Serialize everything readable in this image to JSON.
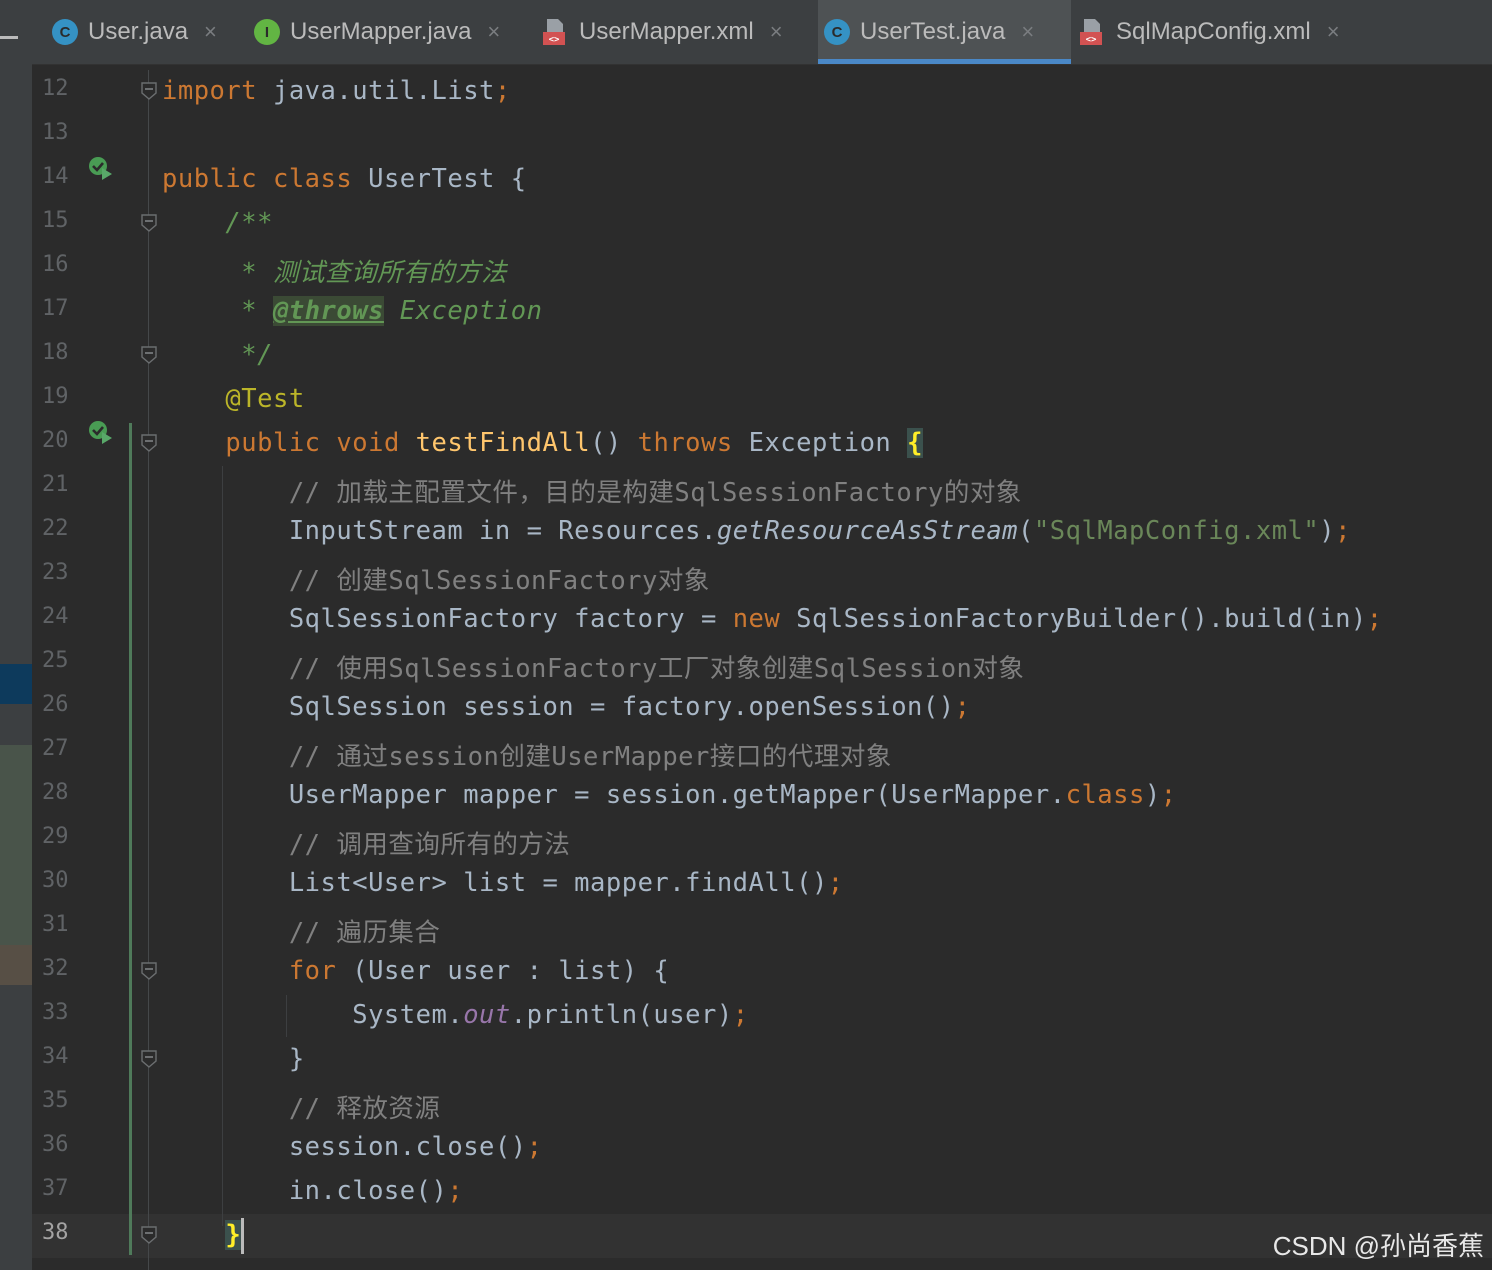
{
  "tabs": [
    {
      "label": "User.java",
      "icon": "class-icon",
      "icon_letter": "C",
      "active": false
    },
    {
      "label": "UserMapper.java",
      "icon": "interface-icon",
      "icon_letter": "I",
      "active": false
    },
    {
      "label": "UserMapper.xml",
      "icon": "xml-file-icon",
      "active": false
    },
    {
      "label": "UserTest.java",
      "icon": "test-class-icon",
      "icon_letter": "C",
      "active": true
    },
    {
      "label": "SqlMapConfig.xml",
      "icon": "xml-file-icon",
      "active": false
    }
  ],
  "tab_close_glyph": "×",
  "editor": {
    "current_line": 38,
    "lines": [
      {
        "n": "12",
        "t": [
          [
            "kw",
            "import"
          ],
          [
            "p",
            " java.util.List"
          ],
          [
            "kw",
            ";"
          ]
        ]
      },
      {
        "n": "13",
        "t": []
      },
      {
        "n": "14",
        "t": [
          [
            "kw",
            "public class"
          ],
          [
            "p",
            " UserTest {"
          ]
        ]
      },
      {
        "n": "15",
        "t": [
          [
            "p",
            "    "
          ],
          [
            "doc",
            "/**"
          ]
        ]
      },
      {
        "n": "16",
        "t": [
          [
            "p",
            "     "
          ],
          [
            "doc",
            "* 测试查询所有的方法"
          ]
        ]
      },
      {
        "n": "17",
        "t": [
          [
            "p",
            "     "
          ],
          [
            "doc",
            "* "
          ],
          [
            "doctag",
            "@throws"
          ],
          [
            "doc",
            " Exception"
          ]
        ]
      },
      {
        "n": "18",
        "t": [
          [
            "p",
            "     "
          ],
          [
            "doc",
            "*/"
          ]
        ]
      },
      {
        "n": "19",
        "t": [
          [
            "p",
            "    "
          ],
          [
            "ann",
            "@Test"
          ]
        ]
      },
      {
        "n": "20",
        "t": [
          [
            "p",
            "    "
          ],
          [
            "kw",
            "public void"
          ],
          [
            "p",
            " "
          ],
          [
            "fn",
            "testFindAll"
          ],
          [
            "p",
            "() "
          ],
          [
            "kw",
            "throws"
          ],
          [
            "p",
            " Exception "
          ],
          [
            "brace",
            "{"
          ]
        ]
      },
      {
        "n": "21",
        "t": [
          [
            "p",
            "        "
          ],
          [
            "cm",
            "// 加载主配置文件，目的是构建SqlSessionFactory的对象"
          ]
        ]
      },
      {
        "n": "22",
        "t": [
          [
            "p",
            "        InputStream in = Resources."
          ],
          [
            "stat",
            "getResourceAsStream"
          ],
          [
            "p",
            "("
          ],
          [
            "str",
            "\"SqlMapConfig.xml\""
          ],
          [
            "p",
            ")"
          ],
          [
            "kw",
            ";"
          ]
        ]
      },
      {
        "n": "23",
        "t": [
          [
            "p",
            "        "
          ],
          [
            "cm",
            "// 创建SqlSessionFactory对象"
          ]
        ]
      },
      {
        "n": "24",
        "t": [
          [
            "p",
            "        SqlSessionFactory factory = "
          ],
          [
            "kw",
            "new"
          ],
          [
            "p",
            " SqlSessionFactoryBuilder().build(in)"
          ],
          [
            "kw",
            ";"
          ]
        ]
      },
      {
        "n": "25",
        "t": [
          [
            "p",
            "        "
          ],
          [
            "cm",
            "// 使用SqlSessionFactory工厂对象创建SqlSession对象"
          ]
        ]
      },
      {
        "n": "26",
        "t": [
          [
            "p",
            "        SqlSession session = factory.openSession()"
          ],
          [
            "kw",
            ";"
          ]
        ]
      },
      {
        "n": "27",
        "t": [
          [
            "p",
            "        "
          ],
          [
            "cm",
            "// 通过session创建UserMapper接口的代理对象"
          ]
        ]
      },
      {
        "n": "28",
        "t": [
          [
            "p",
            "        UserMapper mapper = session.getMapper(UserMapper."
          ],
          [
            "kw",
            "class"
          ],
          [
            "p",
            ")"
          ],
          [
            "kw",
            ";"
          ]
        ]
      },
      {
        "n": "29",
        "t": [
          [
            "p",
            "        "
          ],
          [
            "cm",
            "// 调用查询所有的方法"
          ]
        ]
      },
      {
        "n": "30",
        "t": [
          [
            "p",
            "        List<User> list = mapper.findAll()"
          ],
          [
            "kw",
            ";"
          ]
        ]
      },
      {
        "n": "31",
        "t": [
          [
            "p",
            "        "
          ],
          [
            "cm",
            "// 遍历集合"
          ]
        ]
      },
      {
        "n": "32",
        "t": [
          [
            "p",
            "        "
          ],
          [
            "kw",
            "for"
          ],
          [
            "p",
            " (User user : list) {"
          ]
        ]
      },
      {
        "n": "33",
        "t": [
          [
            "p",
            "            System."
          ],
          [
            "field",
            "out"
          ],
          [
            "p",
            ".println(user)"
          ],
          [
            "kw",
            ";"
          ]
        ]
      },
      {
        "n": "34",
        "t": [
          [
            "p",
            "        }"
          ]
        ]
      },
      {
        "n": "35",
        "t": [
          [
            "p",
            "        "
          ],
          [
            "cm",
            "// 释放资源"
          ]
        ]
      },
      {
        "n": "36",
        "t": [
          [
            "p",
            "        session.close()"
          ],
          [
            "kw",
            ";"
          ]
        ]
      },
      {
        "n": "37",
        "t": [
          [
            "p",
            "        in.close()"
          ],
          [
            "kw",
            ";"
          ]
        ]
      },
      {
        "n": "38",
        "t": [
          [
            "p",
            "    "
          ],
          [
            "brace",
            "}"
          ]
        ]
      }
    ]
  },
  "run_icons_at_lines": [
    "14",
    "20"
  ],
  "fold_markers_at_lines": [
    "12",
    "15",
    "18",
    "20",
    "32",
    "34",
    "38"
  ],
  "watermark": "CSDN @孙尚香蕉",
  "colors": {
    "background": "#2b2b2b",
    "keyword": "#cc7832",
    "comment": "#808080",
    "doc_comment": "#629755",
    "annotation": "#bbb529",
    "string": "#6a8759",
    "method_decl": "#ffc66d",
    "static_field": "#9876aa",
    "tab_underline": "#4a88c7"
  }
}
